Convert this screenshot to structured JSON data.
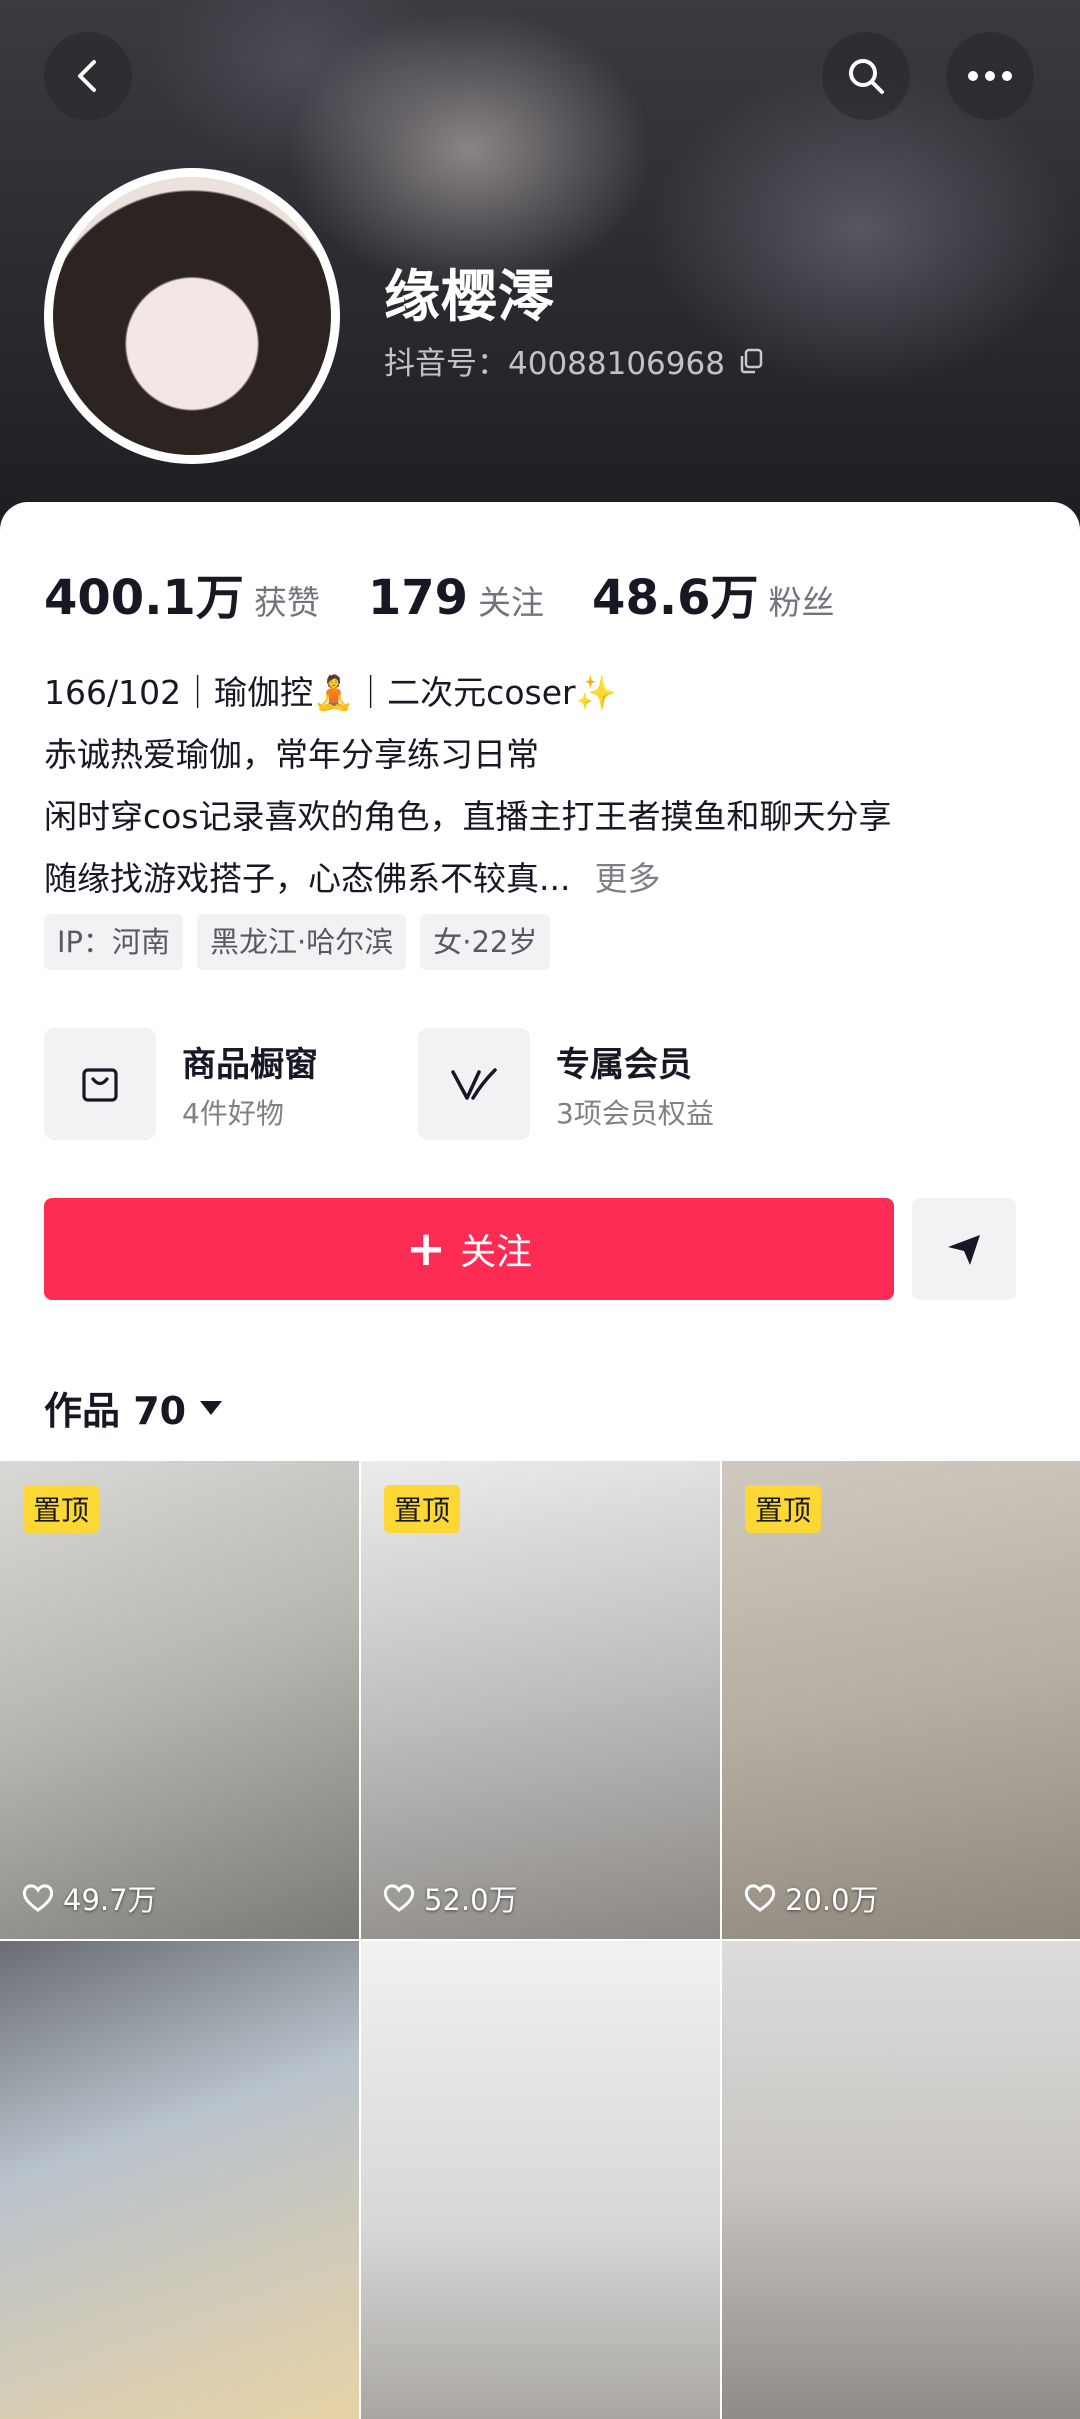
{
  "profile": {
    "nickname": "缘樱澪",
    "douyin_id": "抖音号：40088106968"
  },
  "stats": [
    {
      "value": "400.1万",
      "label": "获赞"
    },
    {
      "value": "179",
      "label": "关注"
    },
    {
      "value": "48.6万",
      "label": "粉丝"
    }
  ],
  "bio": {
    "line1": "166/102｜瑜伽控🧘｜二次元coser✨",
    "line2": "赤诚热爱瑜伽，常年分享练习日常",
    "line3": "闲时穿cos记录喜欢的角色，直播主打王者摸鱼和聊天分享",
    "line4": "随缘找游戏搭子，心态佛系不较真...",
    "more": "更多"
  },
  "tags": [
    "IP：河南",
    "黑龙江·哈尔滨",
    "女·22岁"
  ],
  "shortcuts": {
    "shop": {
      "title": "商品橱窗",
      "subtitle": "4件好物"
    },
    "vip": {
      "title": "专属会员",
      "subtitle": "3项会员权益"
    }
  },
  "actions": {
    "follow_plus": "+",
    "follow_label": "关注"
  },
  "works_tab": {
    "label": "作品 70"
  },
  "grid": [
    {
      "pin": "置顶",
      "likes": "49.7万"
    },
    {
      "pin": "置顶",
      "likes": "52.0万"
    },
    {
      "pin": "置顶",
      "likes": "20.0万"
    },
    {
      "pin": "",
      "likes": ""
    },
    {
      "pin": "",
      "likes": ""
    },
    {
      "pin": "",
      "likes": ""
    }
  ],
  "colors": {
    "accent": "#fe2c55",
    "pin_badge": "#fdd835"
  },
  "icons": [
    "back-icon",
    "search-icon",
    "more-icon",
    "copy-icon",
    "shopping-bag-icon",
    "vip-v-icon",
    "send-icon",
    "heart-icon",
    "caret-down-icon"
  ]
}
